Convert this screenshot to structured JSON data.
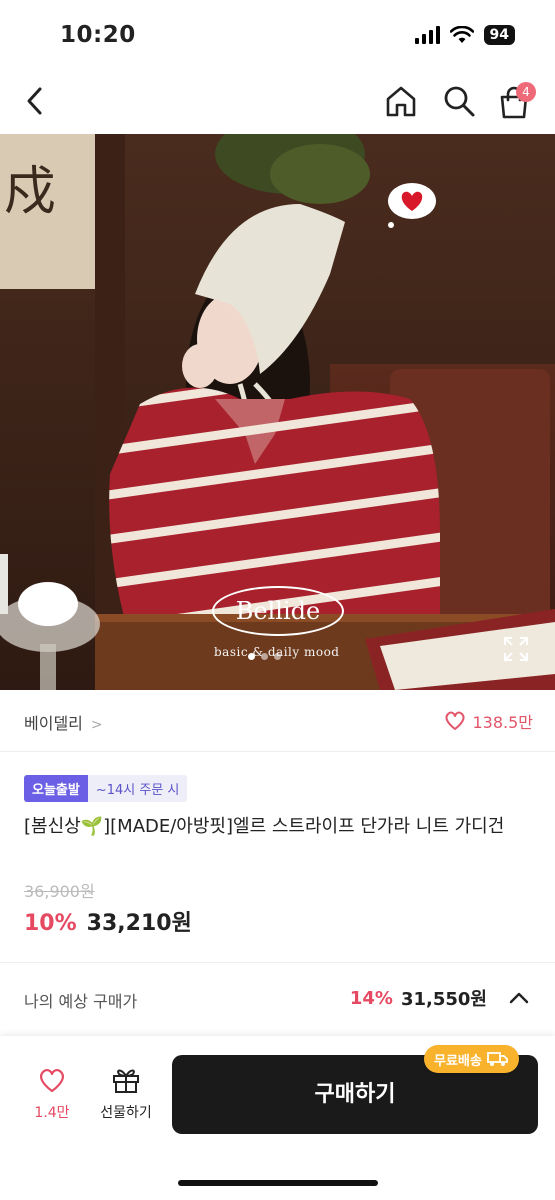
{
  "status": {
    "time": "10:20",
    "battery": "94"
  },
  "nav": {
    "cart_count": "4"
  },
  "hero": {
    "brand": "Bellide",
    "brand_tagline": "basic & daily mood",
    "slide_active": 1,
    "slide_total": 3
  },
  "seller": {
    "name": "베이델리",
    "chevron": ">",
    "likes": "138.5만"
  },
  "product": {
    "badge_today": "오늘출발",
    "badge_cutoff": "~14시 주문 시",
    "title": "[봄신상🌱][MADE/아방핏]엘르 스트라이프 단가라 니트 가디건",
    "original_price": "36,900원",
    "discount": "10%",
    "price": "33,210원"
  },
  "estimate": {
    "label": "나의 예상 구매가",
    "discount": "14%",
    "price": "31,550원"
  },
  "bottom": {
    "like_count": "1.4만",
    "gift_label": "선물하기",
    "buy_label": "구매하기",
    "shipping_badge": "무료배송"
  },
  "colors": {
    "accent": "#e64a62",
    "badge_purple": "#6b5fe6",
    "ship_yellow": "#f8b22c"
  }
}
